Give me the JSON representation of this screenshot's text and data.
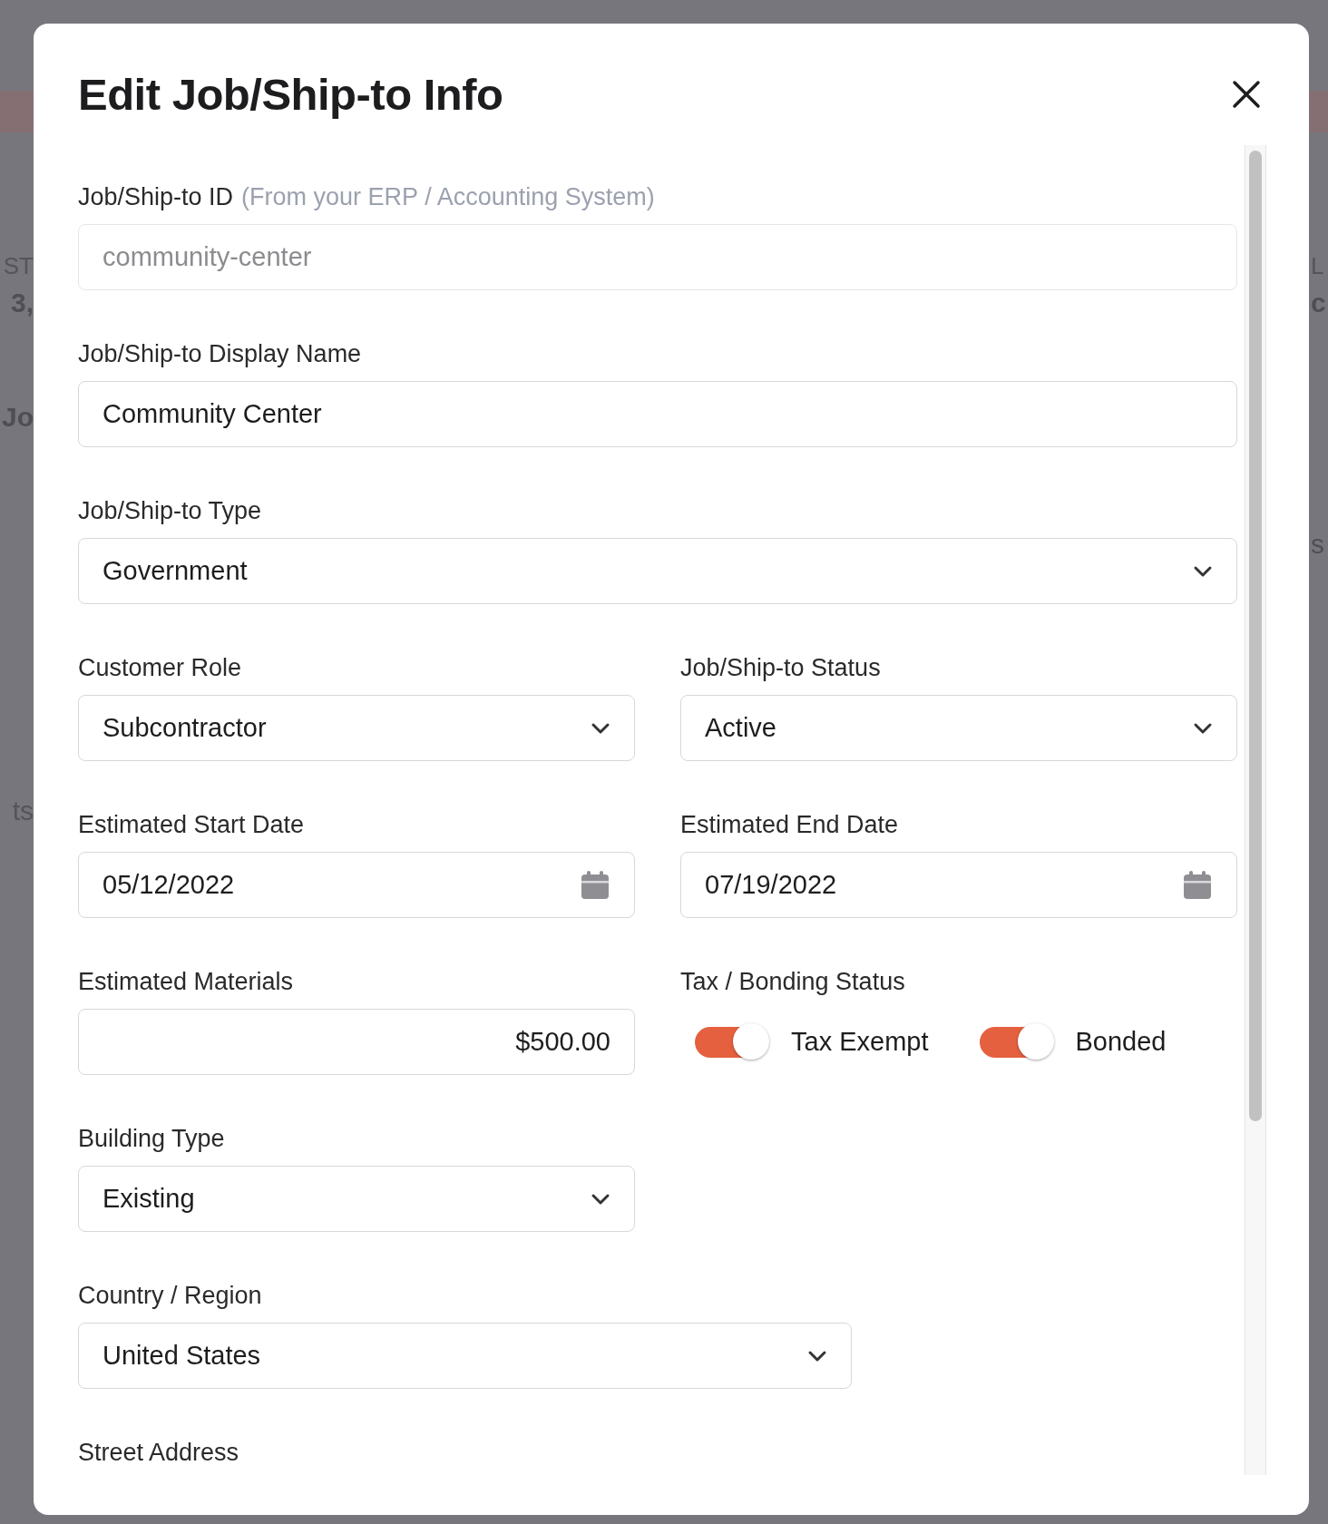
{
  "background": {
    "left_fragments": [
      "ST",
      "3,",
      "Jo",
      "ts"
    ],
    "right_fragments": [
      "L",
      "c",
      "s"
    ]
  },
  "dialog": {
    "title": "Edit Job/Ship-to Info",
    "rows": [
      {
        "kind": "full",
        "fields": [
          {
            "kind": "text",
            "label": "Job/Ship-to ID",
            "hint": "(From your ERP / Accounting System)",
            "value": "community-center",
            "disabled": true
          }
        ]
      },
      {
        "kind": "full",
        "fields": [
          {
            "kind": "text",
            "label": "Job/Ship-to Display Name",
            "value": "Community Center",
            "disabled": false
          }
        ]
      },
      {
        "kind": "full",
        "fields": [
          {
            "kind": "select",
            "label": "Job/Ship-to Type",
            "value": "Government"
          }
        ]
      },
      {
        "kind": "pair",
        "fields": [
          {
            "kind": "select",
            "label": "Customer Role",
            "value": "Subcontractor"
          },
          {
            "kind": "select",
            "label": "Job/Ship-to Status",
            "value": "Active"
          }
        ]
      },
      {
        "kind": "pair",
        "fields": [
          {
            "kind": "date",
            "label": "Estimated Start Date",
            "value": "05/12/2022"
          },
          {
            "kind": "date",
            "label": "Estimated End Date",
            "value": "07/19/2022"
          }
        ]
      },
      {
        "kind": "pair",
        "fields": [
          {
            "kind": "money",
            "label": "Estimated Materials",
            "value": "$500.00"
          },
          {
            "kind": "toggles",
            "label": "Tax / Bonding Status",
            "toggles": [
              {
                "label": "Tax Exempt",
                "on": true
              },
              {
                "label": "Bonded",
                "on": true
              }
            ]
          }
        ]
      },
      {
        "kind": "pair",
        "fields": [
          {
            "kind": "select",
            "label": "Building Type",
            "value": "Existing"
          }
        ]
      },
      {
        "kind": "wide",
        "fields": [
          {
            "kind": "select",
            "label": "Country / Region",
            "value": "United States"
          }
        ]
      },
      {
        "kind": "full",
        "fields": [
          {
            "kind": "label",
            "label": "Street Address"
          }
        ]
      }
    ]
  }
}
